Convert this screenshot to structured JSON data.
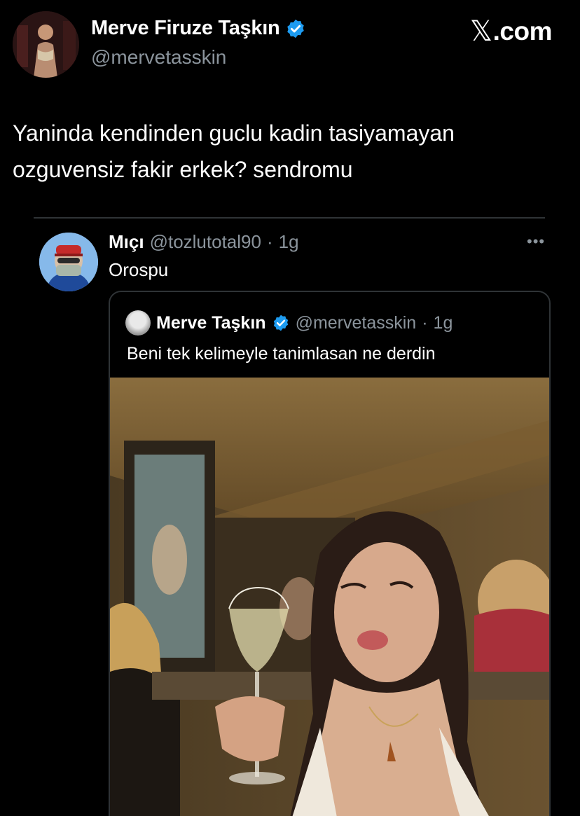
{
  "author": {
    "display_name": "Merve Firuze Taşkın",
    "handle": "@mervetasskin",
    "verified": true,
    "verified_color": "#1d9bf0"
  },
  "brand": {
    "mark": "𝕏",
    "domain": ".com"
  },
  "tweet": {
    "lines": [
      "Yaninda kendinden guclu kadin tasiyamayan",
      "ozguvensiz fakir erkek? sendromu"
    ]
  },
  "reply": {
    "display_name": "Mıçı",
    "handle": "@tozlutotal90",
    "separator": "·",
    "time": "1g",
    "text": "Orospu",
    "more_icon": "•••"
  },
  "quote": {
    "display_name": "Merve Taşkın",
    "verified": true,
    "handle": "@mervetasskin",
    "separator": "·",
    "time": "1g",
    "text": "Beni tek kelimeyle tanimlasan ne derdin"
  },
  "colors": {
    "background": "#000000",
    "text": "#ffffff",
    "muted": "#8b949c",
    "border": "#2f3336"
  }
}
